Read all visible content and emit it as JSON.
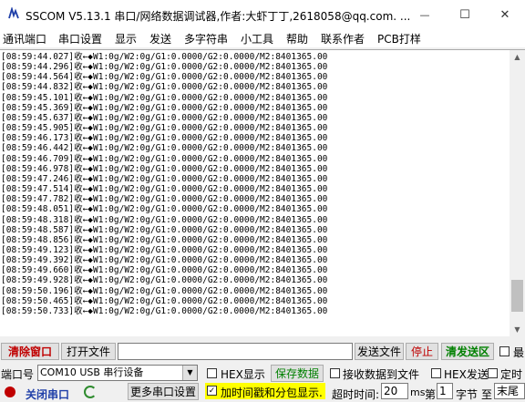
{
  "window": {
    "title": "SSCOM V5.13.1 串口/网络数据调试器,作者:大虾丁丁,2618058@qq.com. ...",
    "minimize_glyph": "—",
    "maximize_glyph": "☐",
    "close_glyph": "✕"
  },
  "menu": {
    "items": [
      "通讯端口",
      "串口设置",
      "显示",
      "发送",
      "多字符串",
      "小工具",
      "帮助",
      "联系作者",
      "PCB打样"
    ]
  },
  "log": {
    "lines": [
      "[08:59:44.027]收←◆W1:0g/W2:0g/G1:0.0000/G2:0.0000/M2:8401365.00",
      "[08:59:44.296]收←◆W1:0g/W2:0g/G1:0.0000/G2:0.0000/M2:8401365.00",
      "[08:59:44.564]收←◆W1:0g/W2:0g/G1:0.0000/G2:0.0000/M2:8401365.00",
      "[08:59:44.832]收←◆W1:0g/W2:0g/G1:0.0000/G2:0.0000/M2:8401365.00",
      "[08:59:45.101]收←◆W1:0g/W2:0g/G1:0.0000/G2:0.0000/M2:8401365.00",
      "[08:59:45.369]收←◆W1:0g/W2:0g/G1:0.0000/G2:0.0000/M2:8401365.00",
      "[08:59:45.637]收←◆W1:0g/W2:0g/G1:0.0000/G2:0.0000/M2:8401365.00",
      "[08:59:45.905]收←◆W1:0g/W2:0g/G1:0.0000/G2:0.0000/M2:8401365.00",
      "[08:59:46.173]收←◆W1:0g/W2:0g/G1:0.0000/G2:0.0000/M2:8401365.00",
      "[08:59:46.442]收←◆W1:0g/W2:0g/G1:0.0000/G2:0.0000/M2:8401365.00",
      "[08:59:46.709]收←◆W1:0g/W2:0g/G1:0.0000/G2:0.0000/M2:8401365.00",
      "[08:59:46.978]收←◆W1:0g/W2:0g/G1:0.0000/G2:0.0000/M2:8401365.00",
      "[08:59:47.246]收←◆W1:0g/W2:0g/G1:0.0000/G2:0.0000/M2:8401365.00",
      "[08:59:47.514]收←◆W1:0g/W2:0g/G1:0.0000/G2:0.0000/M2:8401365.00",
      "[08:59:47.782]收←◆W1:0g/W2:0g/G1:0.0000/G2:0.0000/M2:8401365.00",
      "[08:59:48.051]收←◆W1:0g/W2:0g/G1:0.0000/G2:0.0000/M2:8401365.00",
      "[08:59:48.318]收←◆W1:0g/W2:0g/G1:0.0000/G2:0.0000/M2:8401365.00",
      "[08:59:48.587]收←◆W1:0g/W2:0g/G1:0.0000/G2:0.0000/M2:8401365.00",
      "[08:59:48.856]收←◆W1:0g/W2:0g/G1:0.0000/G2:0.0000/M2:8401365.00",
      "[08:59:49.123]收←◆W1:0g/W2:0g/G1:0.0000/G2:0.0000/M2:8401365.00",
      "[08:59:49.392]收←◆W1:0g/W2:0g/G1:0.0000/G2:0.0000/M2:8401365.00",
      "[08:59:49.660]收←◆W1:0g/W2:0g/G1:0.0000/G2:0.0000/M2:8401365.00",
      "[08:59:49.928]收←◆W1:0g/W2:0g/G1:0.0000/G2:0.0000/M2:8401365.00",
      "[08:59:50.196]收←◆W1:0g/W2:0g/G1:0.0000/G2:0.0000/M2:8401365.00",
      "[08:59:50.465]收←◆W1:0g/W2:0g/G1:0.0000/G2:0.0000/M2:8401365.00",
      "[08:59:50.733]收←◆W1:0g/W2:0g/G1:0.0000/G2:0.0000/M2:8401365.00"
    ],
    "scroll_position": 0.95,
    "scroll_visible_fraction": 0.12
  },
  "row1": {
    "clear_window": "清除窗口",
    "open_file": "打开文件",
    "file_path_value": "",
    "send_file": "发送文件",
    "stop": "停止",
    "clear_send": "清发送区",
    "last_label": "最"
  },
  "row2": {
    "port_label": "端口号",
    "port_value": "COM10 USB 串行设备",
    "hex_display": "HEX显示",
    "save_data": "保存数据",
    "save_to_file": "接收数据到文件",
    "hex_send": "HEX发送",
    "timed_label": "定时"
  },
  "row3": {
    "close_port": "关闭串口",
    "more_settings": "更多串口设置",
    "add_timestamp": "加时间戳和分包显示.",
    "timeout_label": "超时时间:",
    "timeout_value": "20",
    "ms_label": "ms",
    "byte_prefix": "第",
    "byte_value": "1",
    "byte_label": "字节",
    "to_label": "至",
    "end_label": "末尾"
  },
  "colors": {
    "accent_red": "#c00000",
    "green_text": "#008000",
    "timestamp_highlight": "#ffff00"
  }
}
